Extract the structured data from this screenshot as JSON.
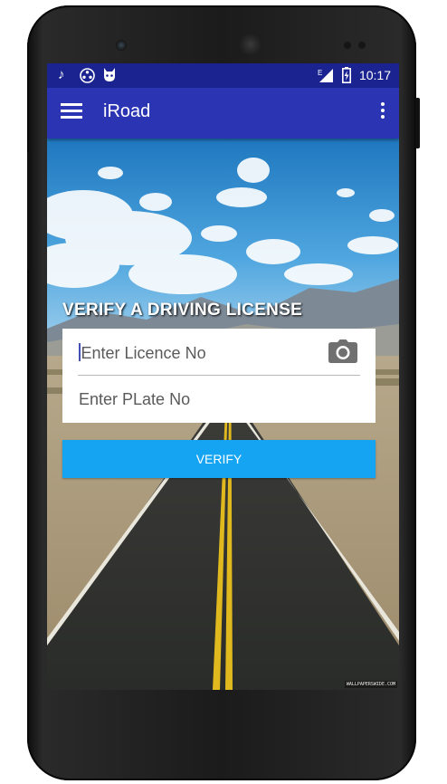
{
  "statusbar": {
    "time": "10:17",
    "left_icons": [
      "music-note-icon",
      "media-reel-icon",
      "cat-robot-icon"
    ],
    "right_icons": [
      "signal-icon",
      "battery-charging-icon"
    ],
    "network_label": "E"
  },
  "appbar": {
    "title": "iRoad",
    "background": "#2b34b3",
    "statusbar_background": "#1a2390"
  },
  "main": {
    "heading": "VERIFY A DRIVING LICENSE",
    "licence_placeholder": "Enter Licence No",
    "plate_placeholder": "Enter PLate No",
    "camera_icon": "camera-icon",
    "verify_label": "VERIFY",
    "verify_color": "#14a4f2",
    "watermark": "WALLPAPERSWIDE.COM"
  }
}
